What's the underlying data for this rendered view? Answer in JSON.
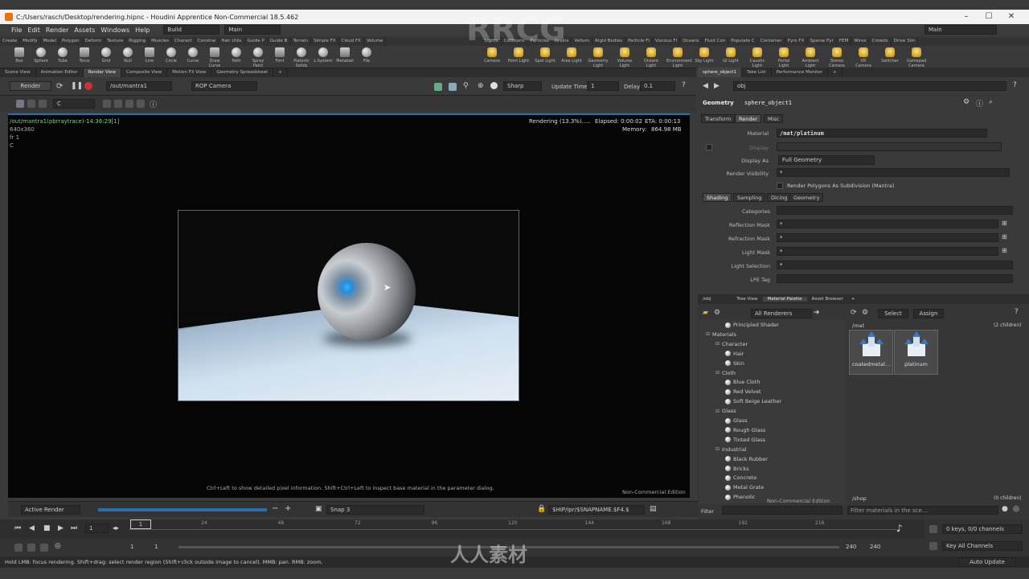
{
  "window": {
    "title": "C:/Users/rasch/Desktop/rendering.hipnc - Houdini Apprentice Non-Commercial 18.5.462"
  },
  "menu": {
    "items": [
      "File",
      "Edit",
      "Render",
      "Assets",
      "Windows",
      "Help"
    ],
    "desktop": "Build",
    "main_label": "Main",
    "right_main": "Main"
  },
  "shelf_tabs_left": [
    "Create",
    "Modify",
    "Model",
    "Polygon",
    "Deform",
    "Texture",
    "Rigging",
    "Muscles",
    "Charact",
    "Constrai",
    "Hair Utils",
    "Guide P",
    "Guide B",
    "Terrain",
    "Simple FX",
    "Cloud FX",
    "Volume"
  ],
  "shelf_tabs_right": [
    "Lights",
    "Collisions",
    "Particles",
    "Grains",
    "Vellum",
    "Rigid Bodies",
    "Particle Fl",
    "Viscous Fl",
    "Oceans",
    "Fluid Con",
    "Populate C",
    "Container",
    "Pyro FX",
    "Sparse Pyr",
    "FEM",
    "Wires",
    "Crowds",
    "Drive Sim"
  ],
  "shelf_tools_left": [
    "Box",
    "Sphere",
    "Tube",
    "Torus",
    "Grid",
    "Null",
    "Line",
    "Circle",
    "Curve",
    "Draw Curve",
    "Path",
    "Spray Paint",
    "Font",
    "Platonic Solids",
    "L-System",
    "Metaball",
    "File"
  ],
  "shelf_tools_right": [
    "Camera",
    "Point Light",
    "Spot Light",
    "Area Light",
    "Geometry Light",
    "Volume Light",
    "Distant Light",
    "Environment Light",
    "Sky Light",
    "GI Light",
    "Caustic Light",
    "Portal Light",
    "Ambient Light",
    "Stereo Camera",
    "VR Camera",
    "Switcher",
    "Gamepad Camera"
  ],
  "pane_tabs": [
    "Scene View",
    "Animation Editor",
    "Render View",
    "Composite View",
    "Motion FX View",
    "Geometry Spreadsheet"
  ],
  "render_toolbar": {
    "render_button": "Render",
    "rop_path": "/out/mantra1",
    "camera": "ROP Camera",
    "sharp": "Sharp",
    "update_time_label": "Update Time",
    "update_time_value": "1",
    "delay_label": "Delay",
    "delay_value": "0.1",
    "channel": "C"
  },
  "viewport": {
    "rop_info": "/out/mantra1(pbrraytrace)-14:36:29[1]",
    "resolution": "640x360",
    "frame": "fr 1",
    "channel": "C",
    "rendering_status": "Rendering (13.3%).....",
    "elapsed": "Elapsed: 0:00:02",
    "eta": "ETA: 0:00:13",
    "memory": "Memory:",
    "memory_value": "864.98 MB",
    "hint": "Ctrl+Left to show detailed pixel information. Shift+Ctrl+Left to inspect base material in the parameter dialog.",
    "noncommercial": "Non-Commercial Edition"
  },
  "viewport_bottom": {
    "active_render": "Active Render",
    "snap": "Snap 3",
    "path": "$HIP/ipr/$SNAPNAME.$F4.$"
  },
  "right_panel": {
    "tabs": [
      "sphere_object1",
      "Take List",
      "Performance Monitor"
    ],
    "path": "obj",
    "node_type": "Geometry",
    "node_name": "sphere_object1",
    "param_tabs": [
      "Transform",
      "Render",
      "Misc"
    ],
    "material_label": "Material",
    "material_value": "/mat/platinum",
    "display_label": "Display",
    "display_as_label": "Display As",
    "display_as_value": "Full Geometry",
    "render_visibility_label": "Render Visibility",
    "render_visibility_value": "*",
    "render_polygons": "Render Polygons As Subdivision (Mantra)",
    "sub_tabs": [
      "Shading",
      "Sampling",
      "Dicing",
      "Geometry"
    ],
    "categories_label": "Categories",
    "reflection_mask_label": "Reflection Mask",
    "reflection_mask_value": "*",
    "refraction_mask_label": "Refraction Mask",
    "refraction_mask_value": "*",
    "light_mask_label": "Light Mask",
    "light_mask_value": "*",
    "light_selection_label": "Light Selection",
    "light_selection_value": "*",
    "lpe_tag_label": "LPE Tag"
  },
  "material_panel": {
    "tabs": [
      "/obj",
      "Tree View",
      "Material Palette",
      "Asset Browser"
    ],
    "renderer": "All Renderers",
    "select_button": "Select",
    "assign_button": "Assign",
    "mat_path": "/mat",
    "mat_count": "(2 children)",
    "shop_path": "/shop",
    "shop_count": "(0 children)",
    "filter_label": "Filter",
    "filter_placeholder": "Filter materials in the sce...",
    "noncommercial": "Non-Commercial Edition",
    "thumbnails": [
      "coatedmetal...",
      "platinum"
    ],
    "tree": [
      {
        "label": "Principled Shader",
        "level": 2,
        "kind": "ball"
      },
      {
        "label": "Materials",
        "level": 0,
        "kind": "folder"
      },
      {
        "label": "Character",
        "level": 1,
        "kind": "folder"
      },
      {
        "label": "Hair",
        "level": 2,
        "kind": "ball"
      },
      {
        "label": "Skin",
        "level": 2,
        "kind": "ball"
      },
      {
        "label": "Cloth",
        "level": 1,
        "kind": "folder"
      },
      {
        "label": "Blue Cloth",
        "level": 2,
        "kind": "ball"
      },
      {
        "label": "Red Velvet",
        "level": 2,
        "kind": "ball"
      },
      {
        "label": "Soft Beige Leather",
        "level": 2,
        "kind": "ball"
      },
      {
        "label": "Glass",
        "level": 1,
        "kind": "folder"
      },
      {
        "label": "Glass",
        "level": 2,
        "kind": "ball"
      },
      {
        "label": "Rough Glass",
        "level": 2,
        "kind": "ball"
      },
      {
        "label": "Tinted Glass",
        "level": 2,
        "kind": "ball"
      },
      {
        "label": "Industrial",
        "level": 1,
        "kind": "folder"
      },
      {
        "label": "Black Rubber",
        "level": 2,
        "kind": "ball"
      },
      {
        "label": "Bricks",
        "level": 2,
        "kind": "ball"
      },
      {
        "label": "Concrete",
        "level": 2,
        "kind": "ball"
      },
      {
        "label": "Metal Grate",
        "level": 2,
        "kind": "ball"
      },
      {
        "label": "Phenolic",
        "level": 2,
        "kind": "ball"
      }
    ]
  },
  "timeline": {
    "current_frame": "1",
    "marker": "1",
    "ticks": [
      "24",
      "48",
      "72",
      "96",
      "120",
      "144",
      "168",
      "192",
      "216"
    ],
    "start": "1",
    "start2": "1",
    "end": "240",
    "end2": "240",
    "keys_info": "0 keys, 0/0 channels",
    "key_all": "Key All Channels",
    "auto_update": "Auto Update"
  },
  "status": {
    "text": "Hold LMB: focus rendering. Shift+drag: select render region (Shift+click outside image to cancel). MMB: pan. RMB: zoom."
  },
  "watermark": {
    "brand": "RRCG",
    "cn": "人人素材"
  },
  "colors": {
    "accent_blue": "#2a6db0",
    "render_bg": "#050505",
    "panel_bg": "#3a3a3a"
  }
}
